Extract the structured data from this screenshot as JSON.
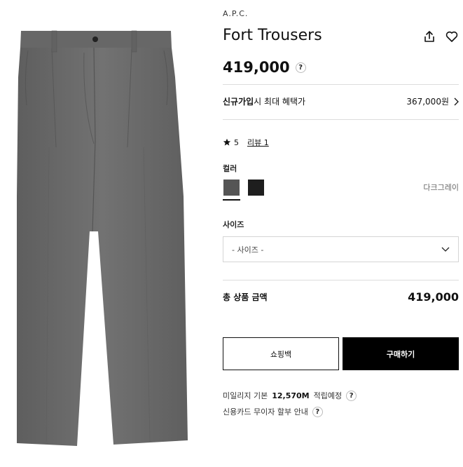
{
  "product": {
    "brand": "A.P.C.",
    "name": "Fort Trousers",
    "price": "419,000",
    "price_help": "?"
  },
  "benefit": {
    "label_bold": "신규가입",
    "label_rest": "시 최대 혜택가",
    "price": "367,000원"
  },
  "review": {
    "rating": "5",
    "link": "리뷰 1"
  },
  "color": {
    "label": "컬러",
    "selected_name": "다크그레이",
    "swatches": [
      "#555555",
      "#1e1e1e"
    ]
  },
  "size": {
    "label": "사이즈",
    "placeholder": "- 사이즈 -"
  },
  "total": {
    "label": "총 상품 금액",
    "price": "419,000"
  },
  "buttons": {
    "cart": "쇼핑백",
    "buy": "구매하기"
  },
  "mileage": {
    "prefix": "미일리지 기본",
    "amount": "12,570M",
    "suffix": "적립예정",
    "help": "?"
  },
  "installment": {
    "text": "신용카드 무이자 할부 안내",
    "help": "?"
  },
  "colors": {
    "trouser": "#6b6b6b",
    "accent": "#000000"
  }
}
